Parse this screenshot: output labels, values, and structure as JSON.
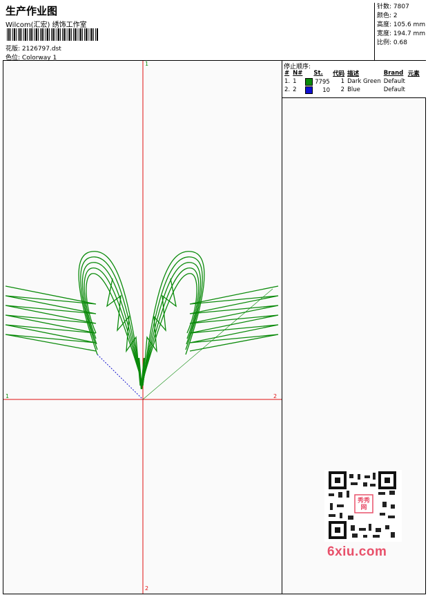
{
  "header": {
    "title": "生产作业图",
    "company": "Wilcom(汇宏) 绣饰工作室",
    "design_label": "花版:",
    "design_name": "2126797.dst",
    "colorway_label": "色位:",
    "colorway_name": "Colorway 1"
  },
  "info": {
    "stitches_label": "针数:",
    "stitches": "7807",
    "colors_label": "颜色:",
    "colors": "2",
    "height_label": "高度:",
    "height": "105.6 mm",
    "width_label": "宽度:",
    "width": "194.7 mm",
    "scale_label": "比例:",
    "scale": "0.68"
  },
  "stops": {
    "heading": "停止顺序:",
    "columns": [
      "#",
      "N#",
      "St.",
      "代码",
      "描述",
      "Brand",
      "元素"
    ],
    "rows": [
      {
        "idx": "1.",
        "n": "1",
        "color": "#0a8a0a",
        "stitches": "7795",
        "code": "1",
        "desc": "Dark Green",
        "brand": "Default"
      },
      {
        "idx": "2.",
        "n": "2",
        "color": "#1010d0",
        "stitches": "10",
        "code": "2",
        "desc": "Blue",
        "brand": "Default"
      }
    ]
  },
  "axes": {
    "top": "1",
    "bottom": "2",
    "left": "1",
    "right": "2"
  },
  "logo": {
    "text": "6xiu.com",
    "seal": "秀秀网"
  },
  "colors": {
    "axis": "#e01010",
    "thread_green": "#0a8a0a",
    "thread_blue": "#1010d0",
    "logo": "#e8506a"
  }
}
